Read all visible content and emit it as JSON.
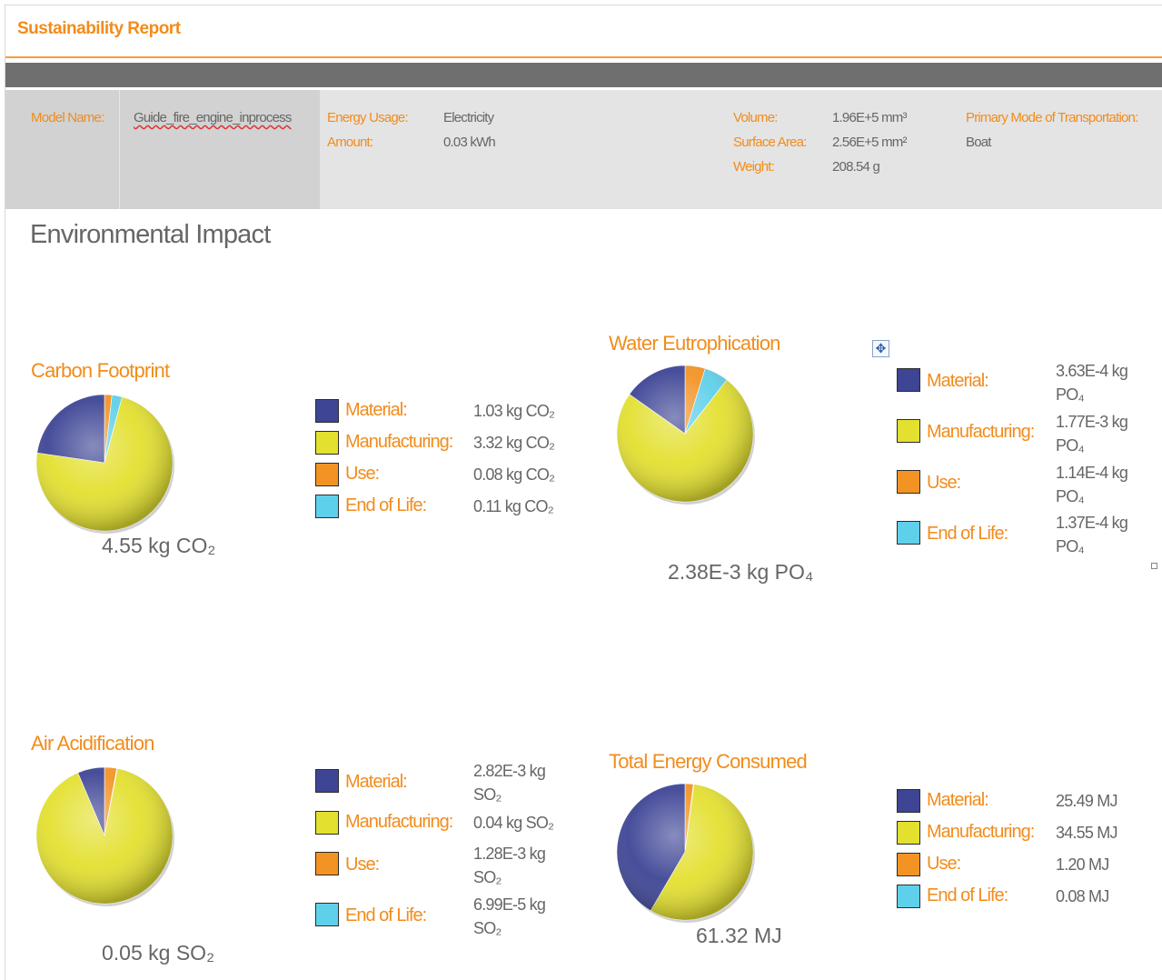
{
  "report": {
    "title": "Sustainability Report"
  },
  "info": {
    "model_name_label": "Model Name:",
    "model_name_value": "Guide_fire_engine_inprocess",
    "energy_usage_label": "Energy Usage:",
    "energy_usage_value": "Electricity",
    "amount_label": "Amount:",
    "amount_value": "0.03 kWh",
    "volume_label": "Volume:",
    "volume_value": "1.96E+5 mm³",
    "surface_area_label": "Surface Area:",
    "surface_area_value": "2.56E+5 mm²",
    "weight_label": "Weight:",
    "weight_value": "208.54 g",
    "transport_label": "Primary Mode of Transportation:",
    "transport_value": "Boat"
  },
  "section_title": "Environmental Impact",
  "colors": {
    "material": "#3e4595",
    "manufacturing": "#e3e030",
    "use": "#f39324",
    "end_of_life": "#5fd0ea",
    "accent": "#f28c1b",
    "text_grey": "#666666"
  },
  "chart_data": [
    {
      "type": "pie",
      "title": "Carbon Footprint",
      "total": "4.55 kg CO₂",
      "categories": [
        "Material:",
        "Manufacturing:",
        "Use:",
        "End of Life:"
      ],
      "values": [
        1.03,
        3.32,
        0.08,
        0.11
      ],
      "labels": [
        "1.03 kg CO₂",
        "3.32 kg CO₂",
        "0.08 kg CO₂",
        "0.11 kg CO₂"
      ]
    },
    {
      "type": "pie",
      "title": "Water Eutrophication",
      "total": "2.38E-3 kg PO₄",
      "categories": [
        "Material:",
        "Manufacturing:",
        "Use:",
        "End of Life:"
      ],
      "values": [
        0.000363,
        0.00177,
        0.000114,
        0.000137
      ],
      "labels": [
        "3.63E-4 kg PO₄",
        "1.77E-3 kg PO₄",
        "1.14E-4 kg PO₄",
        "1.37E-4 kg PO₄"
      ]
    },
    {
      "type": "pie",
      "title": "Air Acidification",
      "total": "0.05 kg SO₂",
      "categories": [
        "Material:",
        "Manufacturing:",
        "Use:",
        "End of Life:"
      ],
      "values": [
        0.00282,
        0.04,
        0.00128,
        6.99e-05
      ],
      "labels": [
        "2.82E-3 kg SO₂",
        "0.04 kg SO₂",
        "1.28E-3 kg SO₂",
        "6.99E-5 kg SO₂"
      ]
    },
    {
      "type": "pie",
      "title": "Total Energy Consumed",
      "total": "61.32 MJ",
      "categories": [
        "Material:",
        "Manufacturing:",
        "Use:",
        "End of Life:"
      ],
      "values": [
        25.49,
        34.55,
        1.2,
        0.08
      ],
      "labels": [
        "25.49 MJ",
        "34.55 MJ",
        "1.20 MJ",
        "0.08 MJ"
      ]
    }
  ]
}
